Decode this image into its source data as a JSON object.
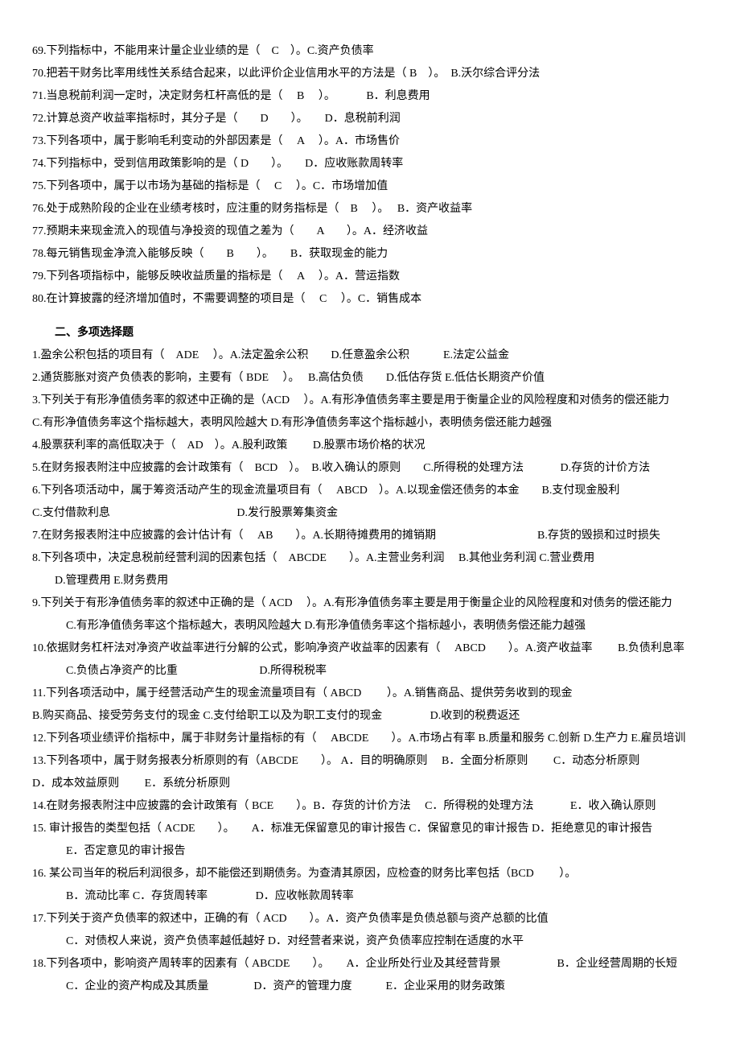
{
  "q69": "69.下列指标中，不能用来计量企业业绩的是（　C　）。C.资产负债率",
  "q70": "70.把若干财务比率用线性关系结合起来，以此评价企业信用水平的方法是（ B　）。　B.沃尔综合评分法",
  "q71": "71.当息税前利润一定时，决定财务杠杆高低的是（　 B　 ）。　　　 B．利息费用",
  "q72": "72.计算总资产收益率指标时，其分子是（　　D　　）。　　D．息税前利润",
  "q73": "73.下列各项中，属于影响毛利变动的外部因素是（　 A　 ）。A．市场售价",
  "q74": "74.下列指标中，受到信用政策影响的是（ D　　）。　　D．应收账款周转率",
  "q75": "75.下列各项中，属于以市场为基础的指标是（　 C　 ）。C．市场增加值",
  "q76": "76.处于成熟阶段的企业在业绩考核时，应注重的财务指标是（　B　 ）。　 B．资产收益率",
  "q77": "77.预期未来现金流入的现值与净投资的现值之差为（　　A　　）。A．经济收益",
  "q78": "78.每元销售现金净流入能够反映（　　B　　）。　　B．获取现金的能力",
  "q79": "79.下列各项指标中，能够反映收益质量的指标是（　 A　 ）。A．营运指数",
  "q80": "80.在计算披露的经济增加值时，不需要调整的项目是（　 C　 ）。C．销售成本",
  "sectionTitle": "二、多项选择题",
  "m1": "1.盈余公积包括的项目有（　ADE　 ）。A.法定盈余公积　　D.任意盈余公积　　　E.法定公益金",
  "m2": "2.通货膨胀对资产负债表的影响，主要有（ BDE　 ）。　 B.高估负债　　D.低估存货 E.低估长期资产价值",
  "m3": "3.下列关于有形净值债务率的叙述中正确的是（ACD　 ）。A.有形净值债务率主要是用于衡量企业的风险程度和对债务的偿还能力",
  "m3b": "C.有形净值债务率这个指标越大，表明风险越大 D.有形净值债务率这个指标越小，表明债务偿还能力越强",
  "m4": "4.股票获利率的高低取决于（　AD　）。A.股利政策　　 D.股票市场价格的状况",
  "m5": "5.在财务报表附注中应披露的会计政策有（　BCD　）。　B.收入确认的原则　　C.所得税的处理方法　　　 D.存货的计价方法",
  "m6": "6.下列各项活动中，属于筹资活动产生的现金流量项目有（　 ABCD　）。A.以现金偿还债务的本金　　B.支付现金股利",
  "m6b": "C.支付借款利息　　　　　　　　　　　 D.发行股票筹集资金",
  "m7": "7.在财务报表附注中应披露的会计估计有（　 AB　　）。A.长期待摊费用的摊销期　　　　　　　　　B.存货的毁损和过时损失",
  "m8": "8.下列各项中，决定息税前经营利润的因素包括（　ABCDE　　）。A.主营业务利润　 B.其他业务利润 C.营业费用",
  "m8b": "D.管理费用 E.财务费用",
  "m9": "9.下列关于有形净值债务率的叙述中正确的是（ ACD　 ）。A.有形净值债务率主要是用于衡量企业的风险程度和对债务的偿还能力",
  "m9b": "C.有形净值债务率这个指标越大，表明风险越大 D.有形净值债务率这个指标越小，表明债务偿还能力越强",
  "m10": "10.依据财务杠杆法对净资产收益率进行分解的公式，影响净资产收益率的因素有（　 ABCD　　）。A.资产收益率　　 B.负债利息率",
  "m10b": "C.负债占净资产的比重　　　　　 　　D.所得税税率",
  "m11": "11.下列各项活动中，属于经营活动产生的现金流量项目有（ ABCD 　　）。A.销售商品、提供劳务收到的现金",
  "m11b": "B.购买商品、接受劳务支付的现金 C.支付给职工以及为职工支付的现金　　　　 D.收到的税费返还",
  "m12": "12.下列各项业绩评价指标中，属于非财务计量指标的有（　 ABCDE　　）。A.市场占有率 B.质量和服务 C.创新 D.生产力 E.雇员培训",
  "m13": "13.下列各项中，属于财务报表分析原则的有（ABCDE　　）。 A．目的明确原则 　B．全面分析原则　　 C．动态分析原则",
  "m13b": "D．成本效益原则　　 E．系统分析原则",
  "m14": "14.在财务报表附注中应披露的会计政策有（ BCE　　）。B．存货的计价方法　 C．所得税的处理方法　　　 E．收入确认原则",
  "m15": "15. 审计报告的类型包括（ ACDE　　）。　　A．标准无保留意见的审计报告 C．保留意见的审计报告 D．拒绝意见的审计报告",
  "m15b": "E．否定意见的审计报告",
  "m16": "16. 某公司当年的税后利润很多，却不能偿还到期债务。为查清其原因，应检查的财务比率包括（BCD　　 ）。",
  "m16b": "B．流动比率 C．存货周转率　　　　 D．应收帐款周转率",
  "m17": "17.下列关于资产负债率的叙述中，正确的有（ ACD　　）。A．资产负债率是负债总额与资产总额的比值",
  "m17b": "C．对债权人来说，资产负债率越低越好 D．对经营者来说，资产负债率应控制在适度的水平",
  "m18": "18.下列各项中，影响资产周转率的因素有（ ABCDE　　）。　　A．企业所处行业及其经营背景　　　　　B．企业经营周期的长短",
  "m18b": "C．企业的资产构成及其质量　　　　D．资产的管理力度　　　E．企业采用的财务政策"
}
